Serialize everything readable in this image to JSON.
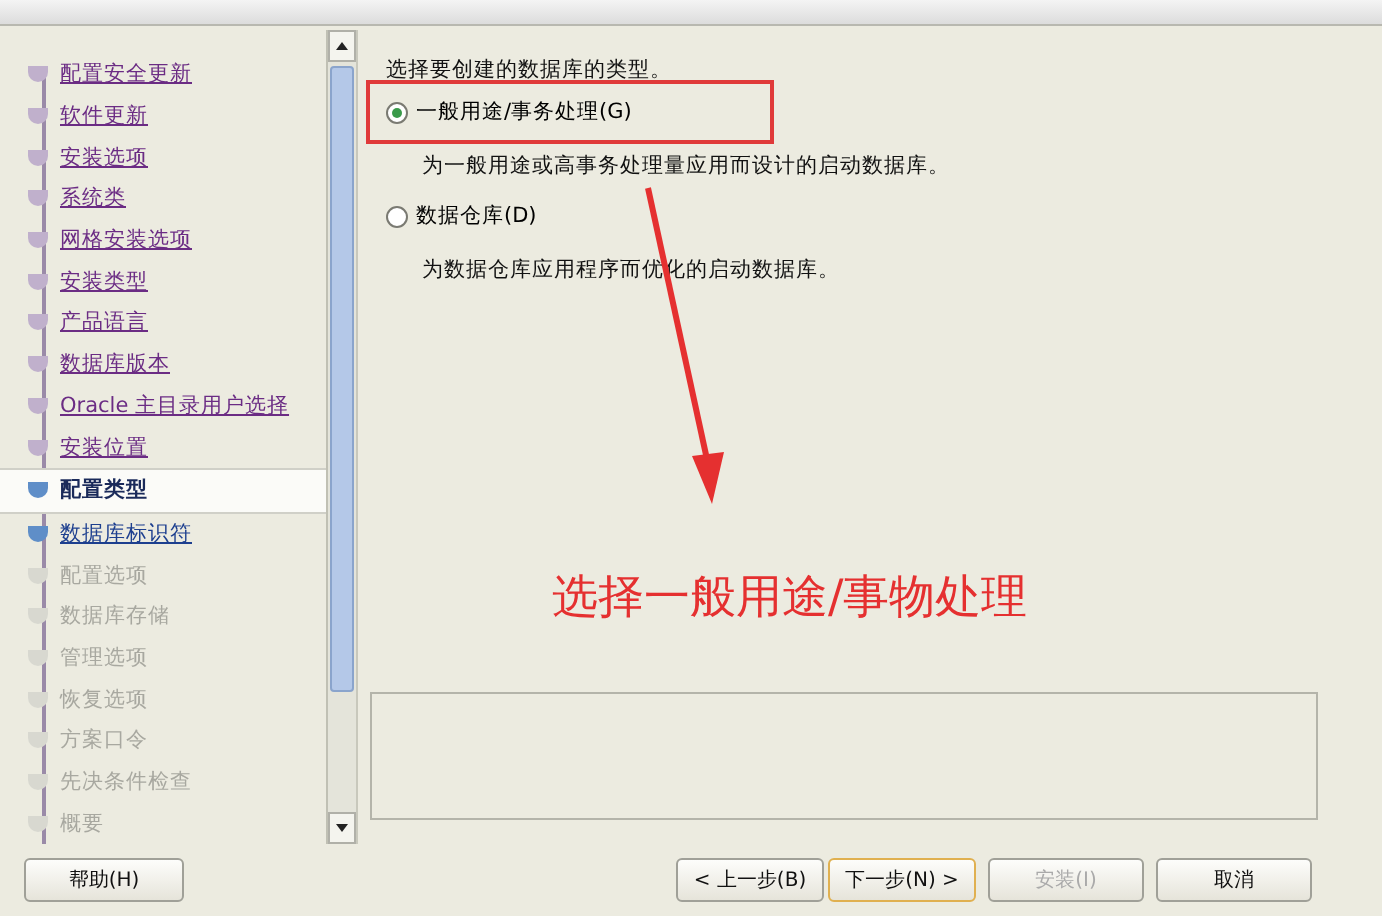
{
  "steps": [
    {
      "label": "配置安全更新",
      "kind": "done",
      "selected": false
    },
    {
      "label": "软件更新",
      "kind": "done",
      "selected": false
    },
    {
      "label": "安装选项",
      "kind": "done",
      "selected": false
    },
    {
      "label": "系统类",
      "kind": "done",
      "selected": false
    },
    {
      "label": "网格安装选项",
      "kind": "done",
      "selected": false
    },
    {
      "label": "安装类型",
      "kind": "done",
      "selected": false
    },
    {
      "label": "产品语言",
      "kind": "done",
      "selected": false
    },
    {
      "label": "数据库版本",
      "kind": "done",
      "selected": false
    },
    {
      "label": "Oracle 主目录用户选择",
      "kind": "done",
      "selected": false
    },
    {
      "label": "安装位置",
      "kind": "done",
      "selected": false
    },
    {
      "label": "配置类型",
      "kind": "current",
      "selected": true
    },
    {
      "label": "数据库标识符",
      "kind": "next",
      "selected": false
    },
    {
      "label": "配置选项",
      "kind": "pending",
      "selected": false
    },
    {
      "label": "数据库存储",
      "kind": "pending",
      "selected": false
    },
    {
      "label": "管理选项",
      "kind": "pending",
      "selected": false
    },
    {
      "label": "恢复选项",
      "kind": "pending",
      "selected": false
    },
    {
      "label": "方案口令",
      "kind": "pending",
      "selected": false
    },
    {
      "label": "先决条件检查",
      "kind": "pending",
      "selected": false
    },
    {
      "label": "概要",
      "kind": "pending",
      "selected": false
    }
  ],
  "prompt": "选择要创建的数据库的类型。",
  "options": [
    {
      "label": "一般用途/事务处理(G)",
      "description": "为一般用途或高事务处理量应用而设计的启动数据库。",
      "selected": true
    },
    {
      "label": "数据仓库(D)",
      "description": "为数据仓库应用程序而优化的启动数据库。",
      "selected": false
    }
  ],
  "annotation": {
    "text": "选择一般用途/事物处理"
  },
  "buttons": {
    "help": {
      "label": "帮助(H)",
      "disabled": false
    },
    "back": {
      "label": "< 上一步(B)",
      "disabled": false
    },
    "next": {
      "label": "下一步(N) >",
      "disabled": false
    },
    "install": {
      "label": "安装(I)",
      "disabled": true
    },
    "cancel": {
      "label": "取消",
      "disabled": false
    }
  }
}
